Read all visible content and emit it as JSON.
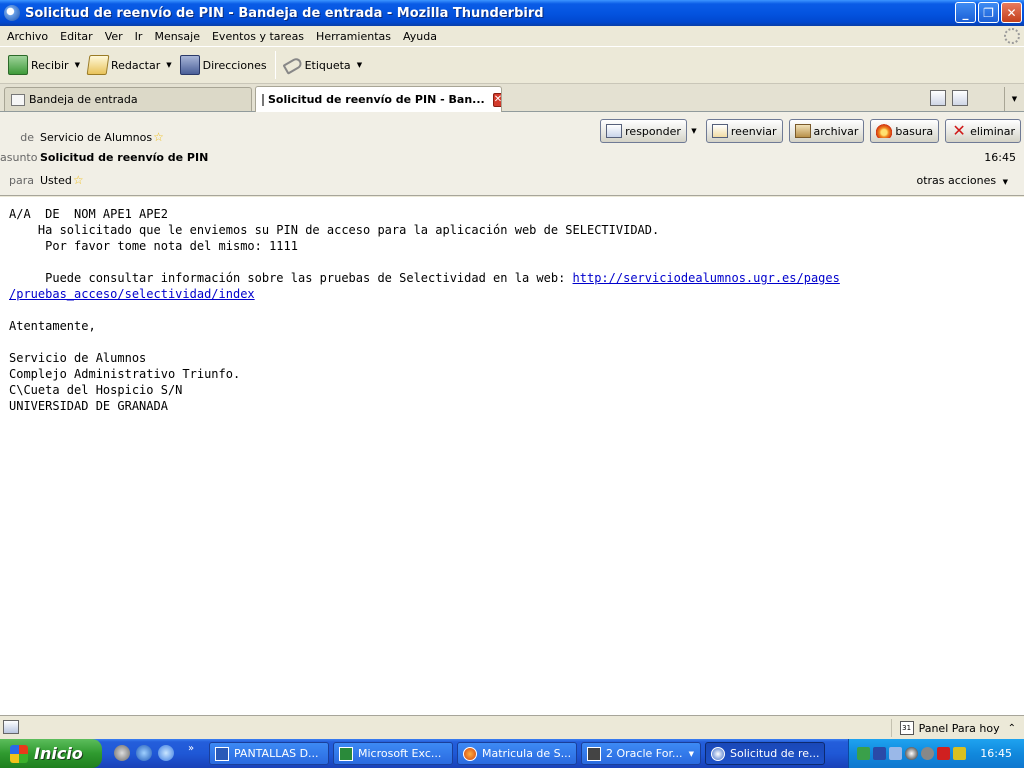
{
  "window": {
    "title": "Solicitud de reenvío de PIN - Bandeja de entrada - Mozilla Thunderbird",
    "minimize": "_",
    "restore": "❐",
    "close": "✕"
  },
  "menu": [
    "Archivo",
    "Editar",
    "Ver",
    "Ir",
    "Mensaje",
    "Eventos y tareas",
    "Herramientas",
    "Ayuda"
  ],
  "toolbar": {
    "get_mail": "Recibir",
    "write": "Redactar",
    "address_book": "Direcciones",
    "tag": "Etiqueta",
    "dropdown_arrow": "▼"
  },
  "tabs": [
    {
      "label": "Bandeja de entrada"
    },
    {
      "label": "Solicitud de reenvío de PIN - Ban..."
    }
  ],
  "header": {
    "from_label": "de",
    "from_value": "Servicio de Alumnos",
    "subject_label": "asunto",
    "subject_value": "Solicitud de reenvío de PIN",
    "to_label": "para",
    "to_value": "Usted",
    "time": "16:45",
    "more_actions": "otras acciones",
    "star": "☆",
    "buttons": {
      "reply": "responder",
      "forward": "reenviar",
      "archive": "archivar",
      "junk": "basura",
      "delete": "eliminar"
    }
  },
  "body": {
    "line1": "A/A  DE  NOM APE1 APE2",
    "line2": "    Ha solicitado que le enviemos su PIN de acceso para la aplicación web de SELECTIVIDAD.",
    "line3": "     Por favor tome nota del mismo: 1111",
    "line4_prefix": "     Puede consultar información sobre las pruebas de Selectividad en la web: ",
    "link_part1": "http://serviciodealumnos.ugr.es/pages",
    "link_part2": "/pruebas_acceso/selectividad/index",
    "closing": "Atentamente,",
    "sig1": "Servicio de Alumnos",
    "sig2": "Complejo Administrativo Triunfo.",
    "sig3": "C\\Cueta del Hospicio S/N",
    "sig4": "UNIVERSIDAD DE GRANADA"
  },
  "statusbar": {
    "today_pane": "Panel Para hoy",
    "calendar_day": "31",
    "up_arrow": "⌃"
  },
  "taskbar": {
    "start": "Inicio",
    "quick_more": "»",
    "tasks": [
      {
        "label": "PANTALLAS D..."
      },
      {
        "label": "Microsoft Exc..."
      },
      {
        "label": "Matricula de S..."
      },
      {
        "label": "2 Oracle For..."
      },
      {
        "label": "Solicitud de re..."
      }
    ],
    "clock": "16:45"
  }
}
